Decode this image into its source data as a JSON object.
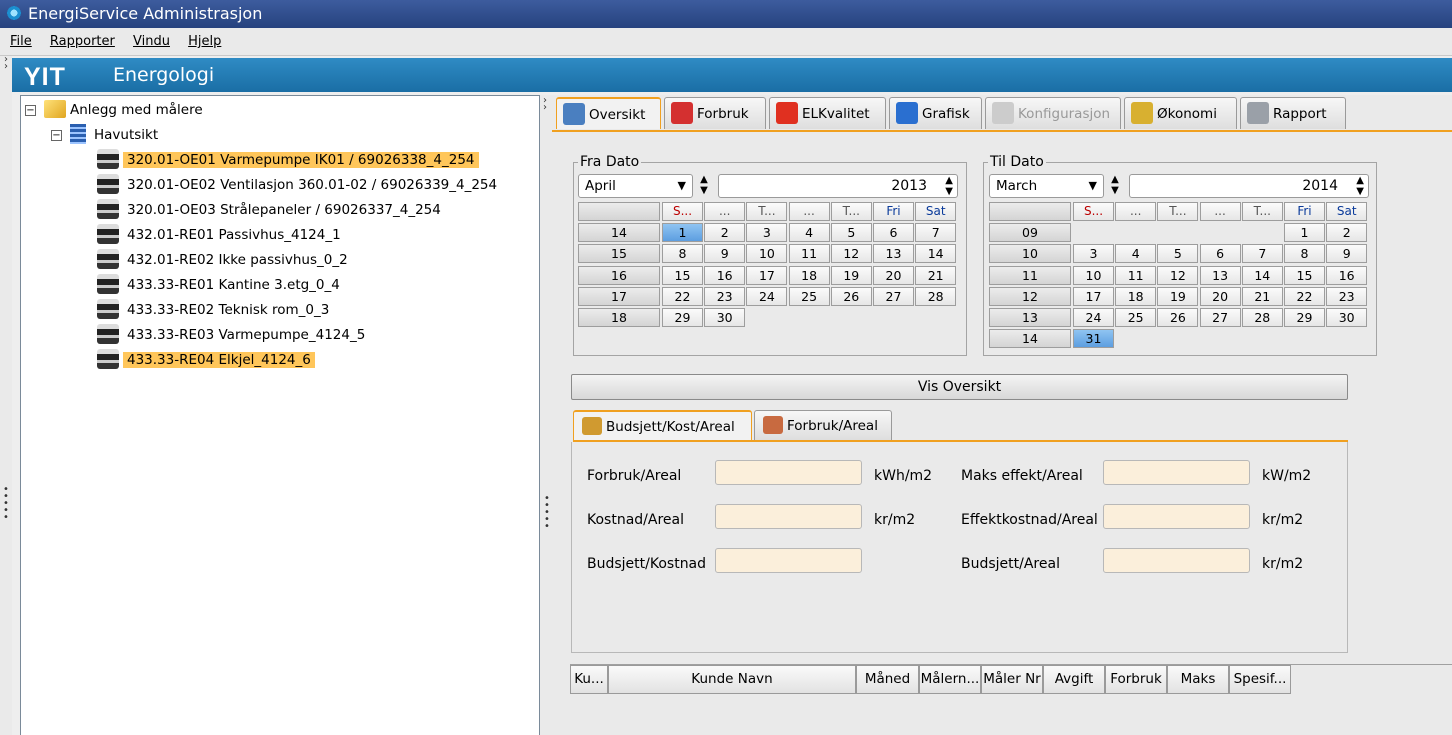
{
  "app": {
    "title": "EnergiService Administrasjon"
  },
  "menu": [
    "File",
    "Rapporter",
    "Vindu",
    "Hjelp"
  ],
  "banner": {
    "logo": "YIT",
    "name": "Energologi"
  },
  "tree": {
    "root": "Anlegg med målere",
    "group": "Havutsikt",
    "items": [
      {
        "label": "320.01-OE01 Varmepumpe IK01 / 69026338_4_254",
        "selected": true
      },
      {
        "label": "320.01-OE02 Ventilasjon 360.01-02 / 69026339_4_254",
        "selected": false
      },
      {
        "label": "320.01-OE03 Strålepaneler / 69026337_4_254",
        "selected": false
      },
      {
        "label": "432.01-RE01 Passivhus_4124_1",
        "selected": false
      },
      {
        "label": "432.01-RE02 Ikke passivhus_0_2",
        "selected": false
      },
      {
        "label": "433.33-RE01 Kantine 3.etg_0_4",
        "selected": false
      },
      {
        "label": "433.33-RE02 Teknisk rom_0_3",
        "selected": false
      },
      {
        "label": "433.33-RE03 Varmepumpe_4124_5",
        "selected": false
      },
      {
        "label": "433.33-RE04 Elkjel_4124_6",
        "selected": true
      }
    ]
  },
  "tabs": [
    {
      "label": "Oversikt",
      "active": true,
      "enabled": true,
      "icon": "overview-icon",
      "color": "#4a7fc0"
    },
    {
      "label": "Forbruk",
      "active": false,
      "enabled": true,
      "icon": "plug-icon",
      "color": "#d43030"
    },
    {
      "label": "ELKvalitet",
      "active": false,
      "enabled": true,
      "icon": "lightning-icon",
      "color": "#e03020"
    },
    {
      "label": "Grafisk",
      "active": false,
      "enabled": true,
      "icon": "chart-icon",
      "color": "#2a6fd0"
    },
    {
      "label": "Konfigurasjon",
      "active": false,
      "enabled": false,
      "icon": "gears-icon",
      "color": "#cccccc"
    },
    {
      "label": "Økonomi",
      "active": false,
      "enabled": true,
      "icon": "money-icon",
      "color": "#d8b030"
    },
    {
      "label": "Rapport",
      "active": false,
      "enabled": true,
      "icon": "report-icon",
      "color": "#9aa0a8"
    }
  ],
  "fra": {
    "legend": "Fra Dato",
    "month": "April",
    "year": "2013",
    "headers": [
      "S...",
      "...",
      "T...",
      "...",
      "T...",
      "Fri",
      "Sat"
    ],
    "weeks": [
      {
        "wk": "14",
        "days": [
          "1",
          "2",
          "3",
          "4",
          "5",
          "6",
          "7"
        ]
      },
      {
        "wk": "15",
        "days": [
          "8",
          "9",
          "10",
          "11",
          "12",
          "13",
          "14"
        ]
      },
      {
        "wk": "16",
        "days": [
          "15",
          "16",
          "17",
          "18",
          "19",
          "20",
          "21"
        ]
      },
      {
        "wk": "17",
        "days": [
          "22",
          "23",
          "24",
          "25",
          "26",
          "27",
          "28"
        ]
      },
      {
        "wk": "18",
        "days": [
          "29",
          "30",
          "",
          "",
          "",
          "",
          ""
        ]
      }
    ],
    "selected_day": "1"
  },
  "til": {
    "legend": "Til Dato",
    "month": "March",
    "year": "2014",
    "headers": [
      "S...",
      "...",
      "T...",
      "...",
      "T...",
      "Fri",
      "Sat"
    ],
    "weeks": [
      {
        "wk": "09",
        "days": [
          "",
          "",
          "",
          "",
          "",
          "1",
          "2"
        ]
      },
      {
        "wk": "10",
        "days": [
          "3",
          "4",
          "5",
          "6",
          "7",
          "8",
          "9"
        ]
      },
      {
        "wk": "11",
        "days": [
          "10",
          "11",
          "12",
          "13",
          "14",
          "15",
          "16"
        ]
      },
      {
        "wk": "12",
        "days": [
          "17",
          "18",
          "19",
          "20",
          "21",
          "22",
          "23"
        ]
      },
      {
        "wk": "13",
        "days": [
          "24",
          "25",
          "26",
          "27",
          "28",
          "29",
          "30"
        ]
      },
      {
        "wk": "14",
        "days": [
          "31",
          "",
          "",
          "",
          "",
          "",
          ""
        ]
      }
    ],
    "selected_day": "31"
  },
  "vis_button": "Vis Oversikt",
  "subtabs": [
    {
      "label": "Budsjett/Kost/Areal",
      "active": true,
      "icon": "coins-icon",
      "color": "#d09a30"
    },
    {
      "label": "Forbruk/Areal",
      "active": false,
      "icon": "books-icon",
      "color": "#c86a40"
    }
  ],
  "fields": {
    "forbruk_areal": {
      "label": "Forbruk/Areal",
      "unit": "kWh/m2",
      "value": ""
    },
    "kostnad_areal": {
      "label": "Kostnad/Areal",
      "unit": "kr/m2",
      "value": ""
    },
    "budsjett_kostnad": {
      "label": "Budsjett/Kostnad",
      "value": ""
    },
    "maks_effekt_areal": {
      "label": "Maks effekt/Areal",
      "unit": "kW/m2",
      "value": ""
    },
    "effektkostnad_areal": {
      "label": "Effektkostnad/Areal",
      "unit": "kr/m2",
      "value": ""
    },
    "budsjett_areal": {
      "label": "Budsjett/Areal",
      "unit": "kr/m2",
      "value": ""
    }
  },
  "table": {
    "columns": [
      "Ku...",
      "Kunde Navn",
      "Måned",
      "Målern...",
      "Måler Nr",
      "Avgift",
      "Forbruk",
      "Maks",
      "Spesif..."
    ]
  }
}
